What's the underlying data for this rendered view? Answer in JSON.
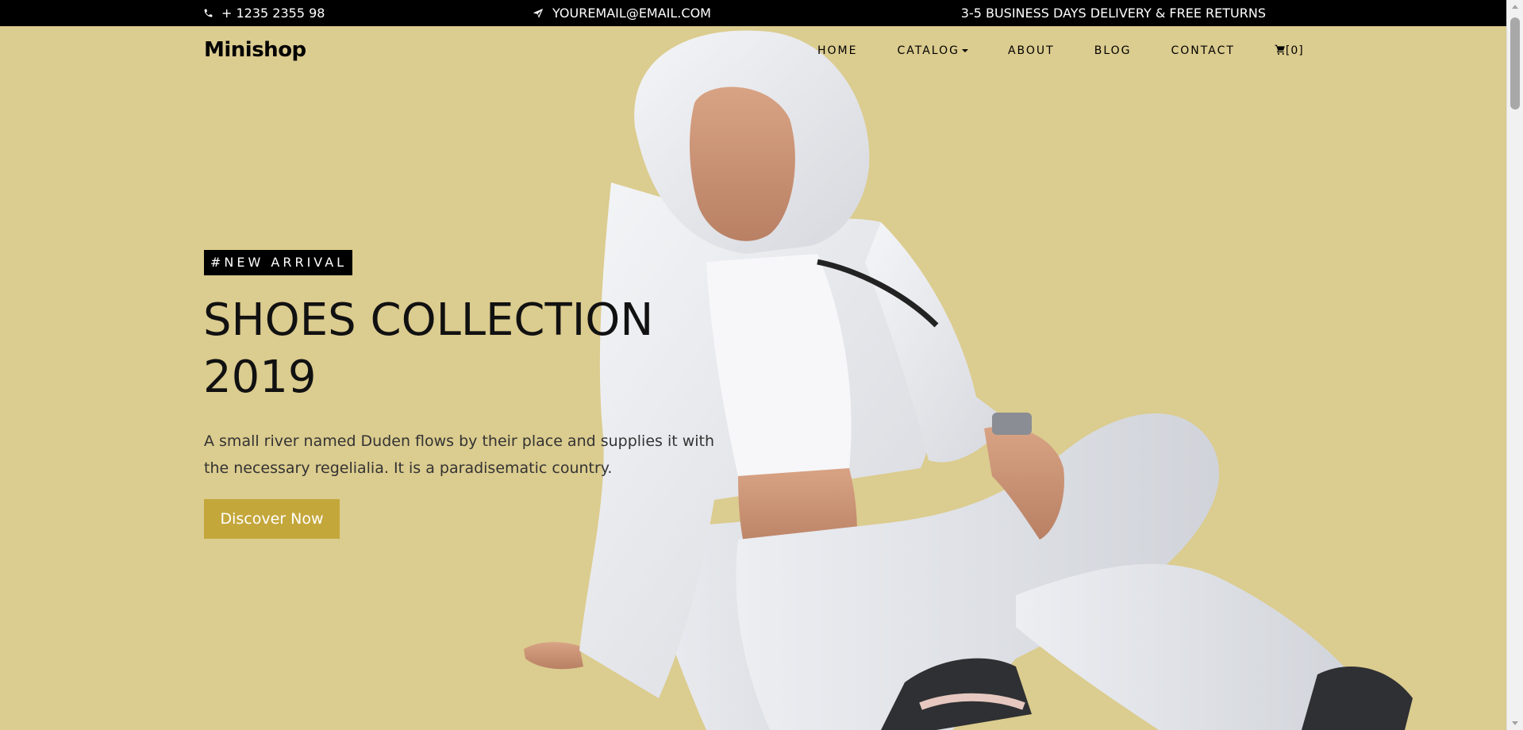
{
  "topbar": {
    "phone": "+ 1235 2355 98",
    "email": "YOUREMAIL@EMAIL.COM",
    "delivery": "3-5 BUSINESS DAYS DELIVERY & FREE RETURNS",
    "phone_icon": "phone-icon",
    "email_icon": "paper-plane-icon"
  },
  "brand": {
    "name": "Minishop"
  },
  "nav": {
    "items": [
      {
        "label": "HOME"
      },
      {
        "label": "CATALOG"
      },
      {
        "label": "ABOUT"
      },
      {
        "label": "BLOG"
      },
      {
        "label": "CONTACT"
      }
    ],
    "cart": {
      "icon": "cart-icon",
      "count_label": "[0]"
    }
  },
  "hero": {
    "badge": "#NEW ARRIVAL",
    "title": "SHOES COLLECTION 2019",
    "description": "A small river named Duden flows by their place and supplies it with the necessary regelialia. It is a paradisematic country.",
    "cta_label": "Discover Now",
    "image_icon": "model-photo"
  },
  "colors": {
    "hero_background": "#dbcc8f",
    "accent": "#c4a73b",
    "topbar_background": "#000000",
    "text": "#111111"
  }
}
